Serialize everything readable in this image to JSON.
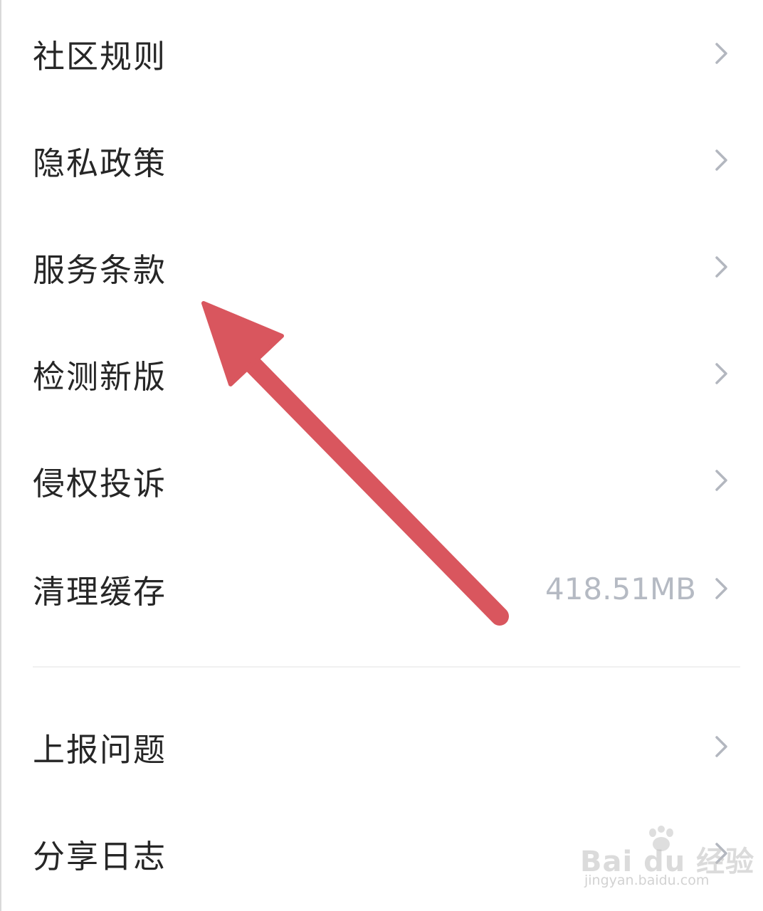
{
  "settings": {
    "items": [
      {
        "label": "社区规则",
        "value": ""
      },
      {
        "label": "隐私政策",
        "value": ""
      },
      {
        "label": "服务条款",
        "value": ""
      },
      {
        "label": "检测新版",
        "value": ""
      },
      {
        "label": "侵权投诉",
        "value": ""
      },
      {
        "label": "清理缓存",
        "value": "418.51MB"
      },
      {
        "label": "上报问题",
        "value": ""
      },
      {
        "label": "分享日志",
        "value": ""
      }
    ]
  },
  "colors": {
    "text": "#262626",
    "value_text": "#b5bac3",
    "chevron": "#b3b7bf",
    "annotation_arrow": "#d9565e",
    "divider": "#f0f0f0"
  },
  "icons": {
    "row_trailing": "chevron-right-icon"
  },
  "watermark": {
    "brand": "Bai du 经验",
    "url": "jingyan.baidu.com"
  }
}
